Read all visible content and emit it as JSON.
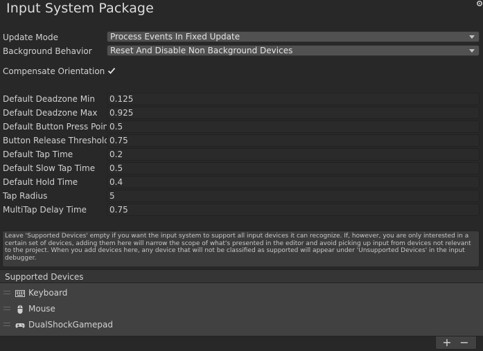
{
  "header": {
    "title": "Input System Package",
    "settings_icon": "gear-icon"
  },
  "settings": {
    "update_mode": {
      "label": "Update Mode",
      "value": "Process Events In Fixed Update"
    },
    "background_behavior": {
      "label": "Background Behavior",
      "value": "Reset And Disable Non Background Devices"
    },
    "compensate_orientation": {
      "label": "Compensate Orientation",
      "checked": true
    }
  },
  "numeric_fields": [
    {
      "label": "Default Deadzone Min",
      "value": "0.125"
    },
    {
      "label": "Default Deadzone Max",
      "value": "0.925"
    },
    {
      "label": "Default Button Press Point",
      "value": "0.5"
    },
    {
      "label": "Button Release Threshold",
      "value": "0.75"
    },
    {
      "label": "Default Tap Time",
      "value": "0.2"
    },
    {
      "label": "Default Slow Tap Time",
      "value": "0.5"
    },
    {
      "label": "Default Hold Time",
      "value": "0.4"
    },
    {
      "label": "Tap Radius",
      "value": "5"
    },
    {
      "label": "MultiTap Delay Time",
      "value": "0.75"
    }
  ],
  "help_text": "Leave 'Supported Devices' empty if you want the input system to support all input devices it can recognize. If, however, you are only interested in a certain set of devices, adding them here will narrow the scope of what's presented in the editor and avoid picking up input from devices not relevant to the project. When you add devices here, any device that will not be classified as supported will appear under 'Unsupported Devices' in the input debugger.",
  "supported_devices": {
    "header": "Supported Devices",
    "items": [
      {
        "label": "Keyboard",
        "icon": "keyboard-icon"
      },
      {
        "label": "Mouse",
        "icon": "mouse-icon"
      },
      {
        "label": "DualShockGamepad",
        "icon": "gamepad-icon"
      }
    ],
    "add_label": "+",
    "remove_label": "−"
  },
  "colors": {
    "background": "#282828",
    "dropdown": "#515151",
    "field": "#2a2a2a",
    "list": "#414141"
  }
}
